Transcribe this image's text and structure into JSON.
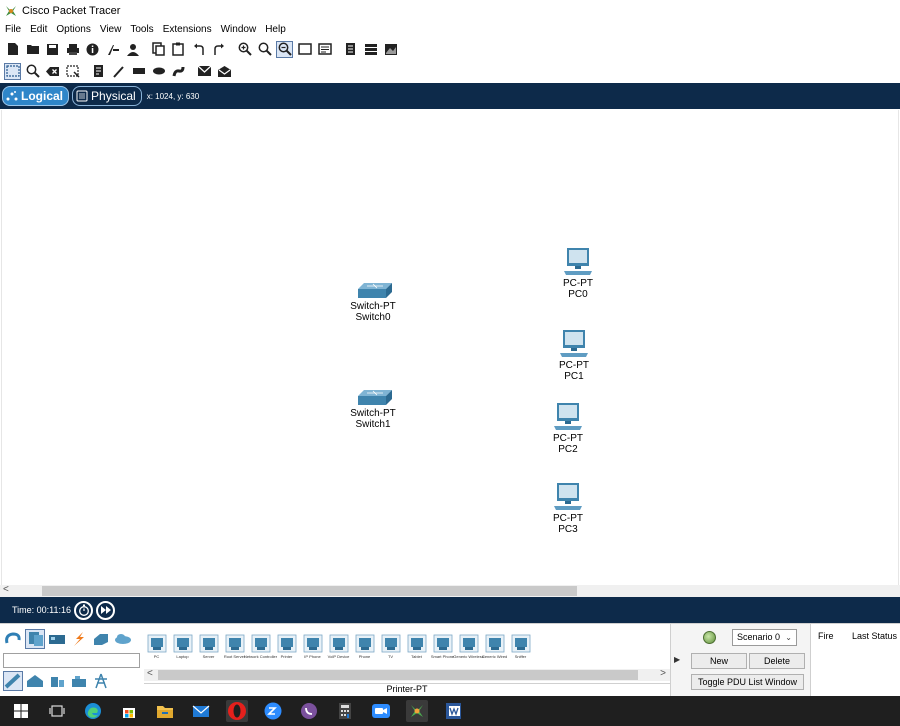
{
  "window": {
    "title": "Cisco Packet Tracer"
  },
  "menu": [
    "File",
    "Edit",
    "Options",
    "View",
    "Tools",
    "Extensions",
    "Window",
    "Help"
  ],
  "toolbar1": [
    {
      "name": "new-file-icon"
    },
    {
      "name": "open-folder-icon"
    },
    {
      "name": "save-icon"
    },
    {
      "name": "print-icon"
    },
    {
      "name": "info-icon"
    },
    {
      "name": "activity-wizard-icon"
    },
    {
      "name": "user-profile-icon"
    },
    {
      "name": "copy-icon"
    },
    {
      "name": "paste-icon"
    },
    {
      "name": "undo-icon"
    },
    {
      "name": "redo-icon"
    },
    {
      "name": "zoom-in-icon"
    },
    {
      "name": "zoom-reset-icon"
    },
    {
      "name": "zoom-out-icon"
    },
    {
      "name": "drawing-palette-icon"
    },
    {
      "name": "custom-device-dialog-icon"
    },
    {
      "name": "view-command-log-icon"
    },
    {
      "name": "network-info-icon"
    },
    {
      "name": "screenshot-icon"
    }
  ],
  "toolbar2": [
    {
      "name": "select-icon"
    },
    {
      "name": "inspect-icon"
    },
    {
      "name": "delete-icon"
    },
    {
      "name": "resize-shape-icon"
    },
    {
      "name": "place-note-icon"
    },
    {
      "name": "draw-line-icon"
    },
    {
      "name": "draw-rectangle-icon"
    },
    {
      "name": "draw-ellipse-icon"
    },
    {
      "name": "draw-freeform-icon"
    },
    {
      "name": "add-simple-pdu-icon"
    },
    {
      "name": "add-complex-pdu-icon"
    }
  ],
  "modes": {
    "logical": "Logical",
    "physical": "Physical",
    "coords": "x: 1024, y: 630"
  },
  "devices": [
    {
      "model": "Switch-PT",
      "name": "Switch0",
      "kind": "switch"
    },
    {
      "model": "Switch-PT",
      "name": "Switch1",
      "kind": "switch"
    },
    {
      "model": "PC-PT",
      "name": "PC0",
      "kind": "pc"
    },
    {
      "model": "PC-PT",
      "name": "PC1",
      "kind": "pc"
    },
    {
      "model": "PC-PT",
      "name": "PC2",
      "kind": "pc"
    },
    {
      "model": "PC-PT",
      "name": "PC3",
      "kind": "pc"
    }
  ],
  "time": {
    "label": "Time: 00:11:16"
  },
  "device_types": [
    "PC",
    "Laptop",
    "Server",
    "Root Server",
    "Network Controller",
    "Printer",
    "IP Phone",
    "VoIP Device",
    "Phone",
    "TV",
    "Tablet",
    "Smart Phone",
    "Generic Wireless",
    "Generic Wired",
    "Sniffer"
  ],
  "selected_device": "Printer-PT",
  "scenario": {
    "selected": "Scenario 0",
    "new": "New",
    "delete": "Delete",
    "toggle": "Toggle PDU List Window"
  },
  "pdu_columns": {
    "fire": "Fire",
    "last_status": "Last Status"
  },
  "colors": {
    "dark_bar": "#0d2a4a",
    "accent": "#2f86c9",
    "device_blue": "#4a8fb8"
  }
}
